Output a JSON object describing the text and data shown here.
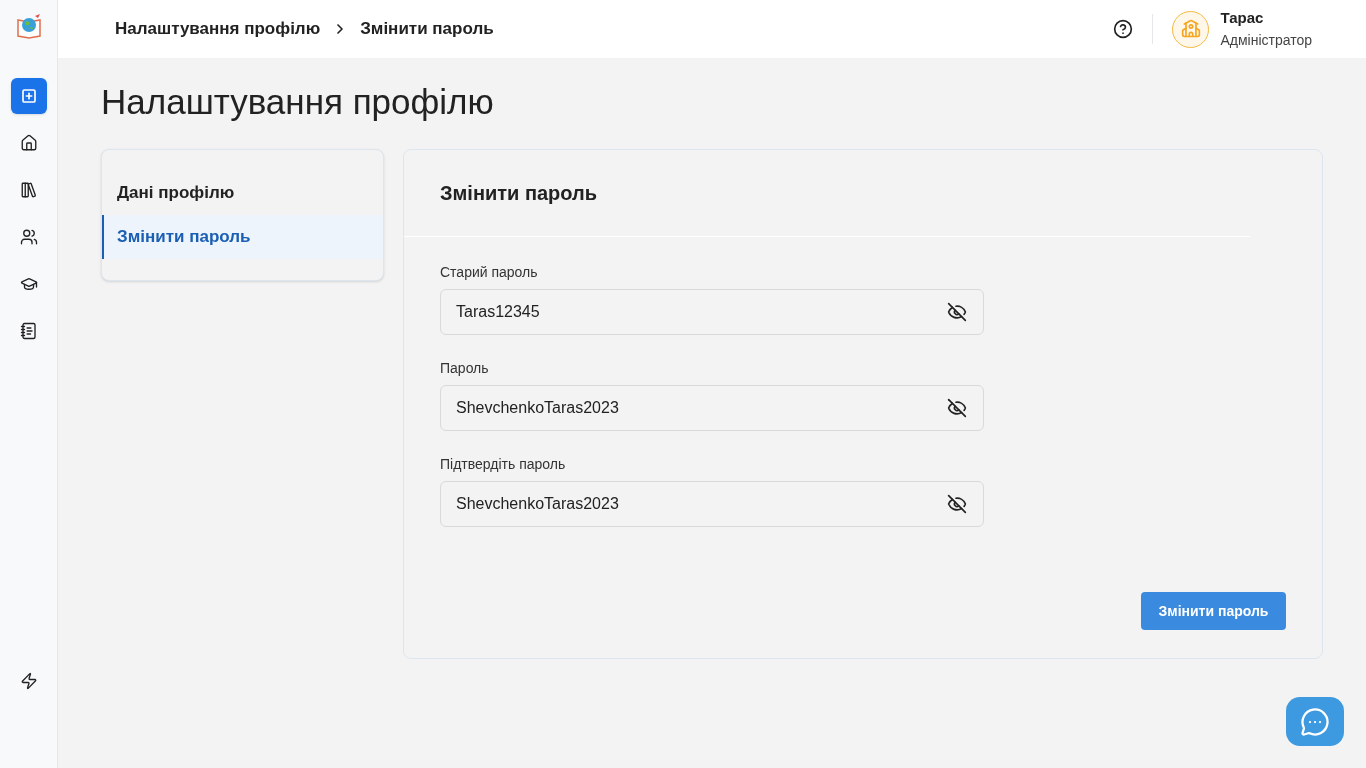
{
  "sidebar": {
    "items": [
      {
        "kind": "new",
        "selected": true
      },
      {
        "kind": "home",
        "selected": false
      },
      {
        "kind": "library",
        "selected": false
      },
      {
        "kind": "users",
        "selected": false
      },
      {
        "kind": "courses",
        "selected": false
      },
      {
        "kind": "journal",
        "selected": false
      }
    ]
  },
  "header": {
    "breadcrumbs": [
      "Налаштування профілю",
      "Змінити пароль"
    ],
    "user": {
      "name": "Тарас",
      "role": "Адміністратор"
    }
  },
  "page_title": "Налаштування профілю",
  "profile_menu": [
    {
      "label": "Дані профілю",
      "selected": false
    },
    {
      "label": "Змінити пароль",
      "selected": true
    }
  ],
  "form": {
    "title": "Змінити пароль",
    "fields": [
      {
        "label": "Старий пароль",
        "value": "Taras12345",
        "revealed": true
      },
      {
        "label": "Пароль",
        "value": "ShevchenkoTaras2023",
        "revealed": true
      },
      {
        "label": "Підтвердіть пароль",
        "value": "ShevchenkoTaras2023",
        "revealed": true
      }
    ],
    "submit": "Змінити пароль"
  }
}
